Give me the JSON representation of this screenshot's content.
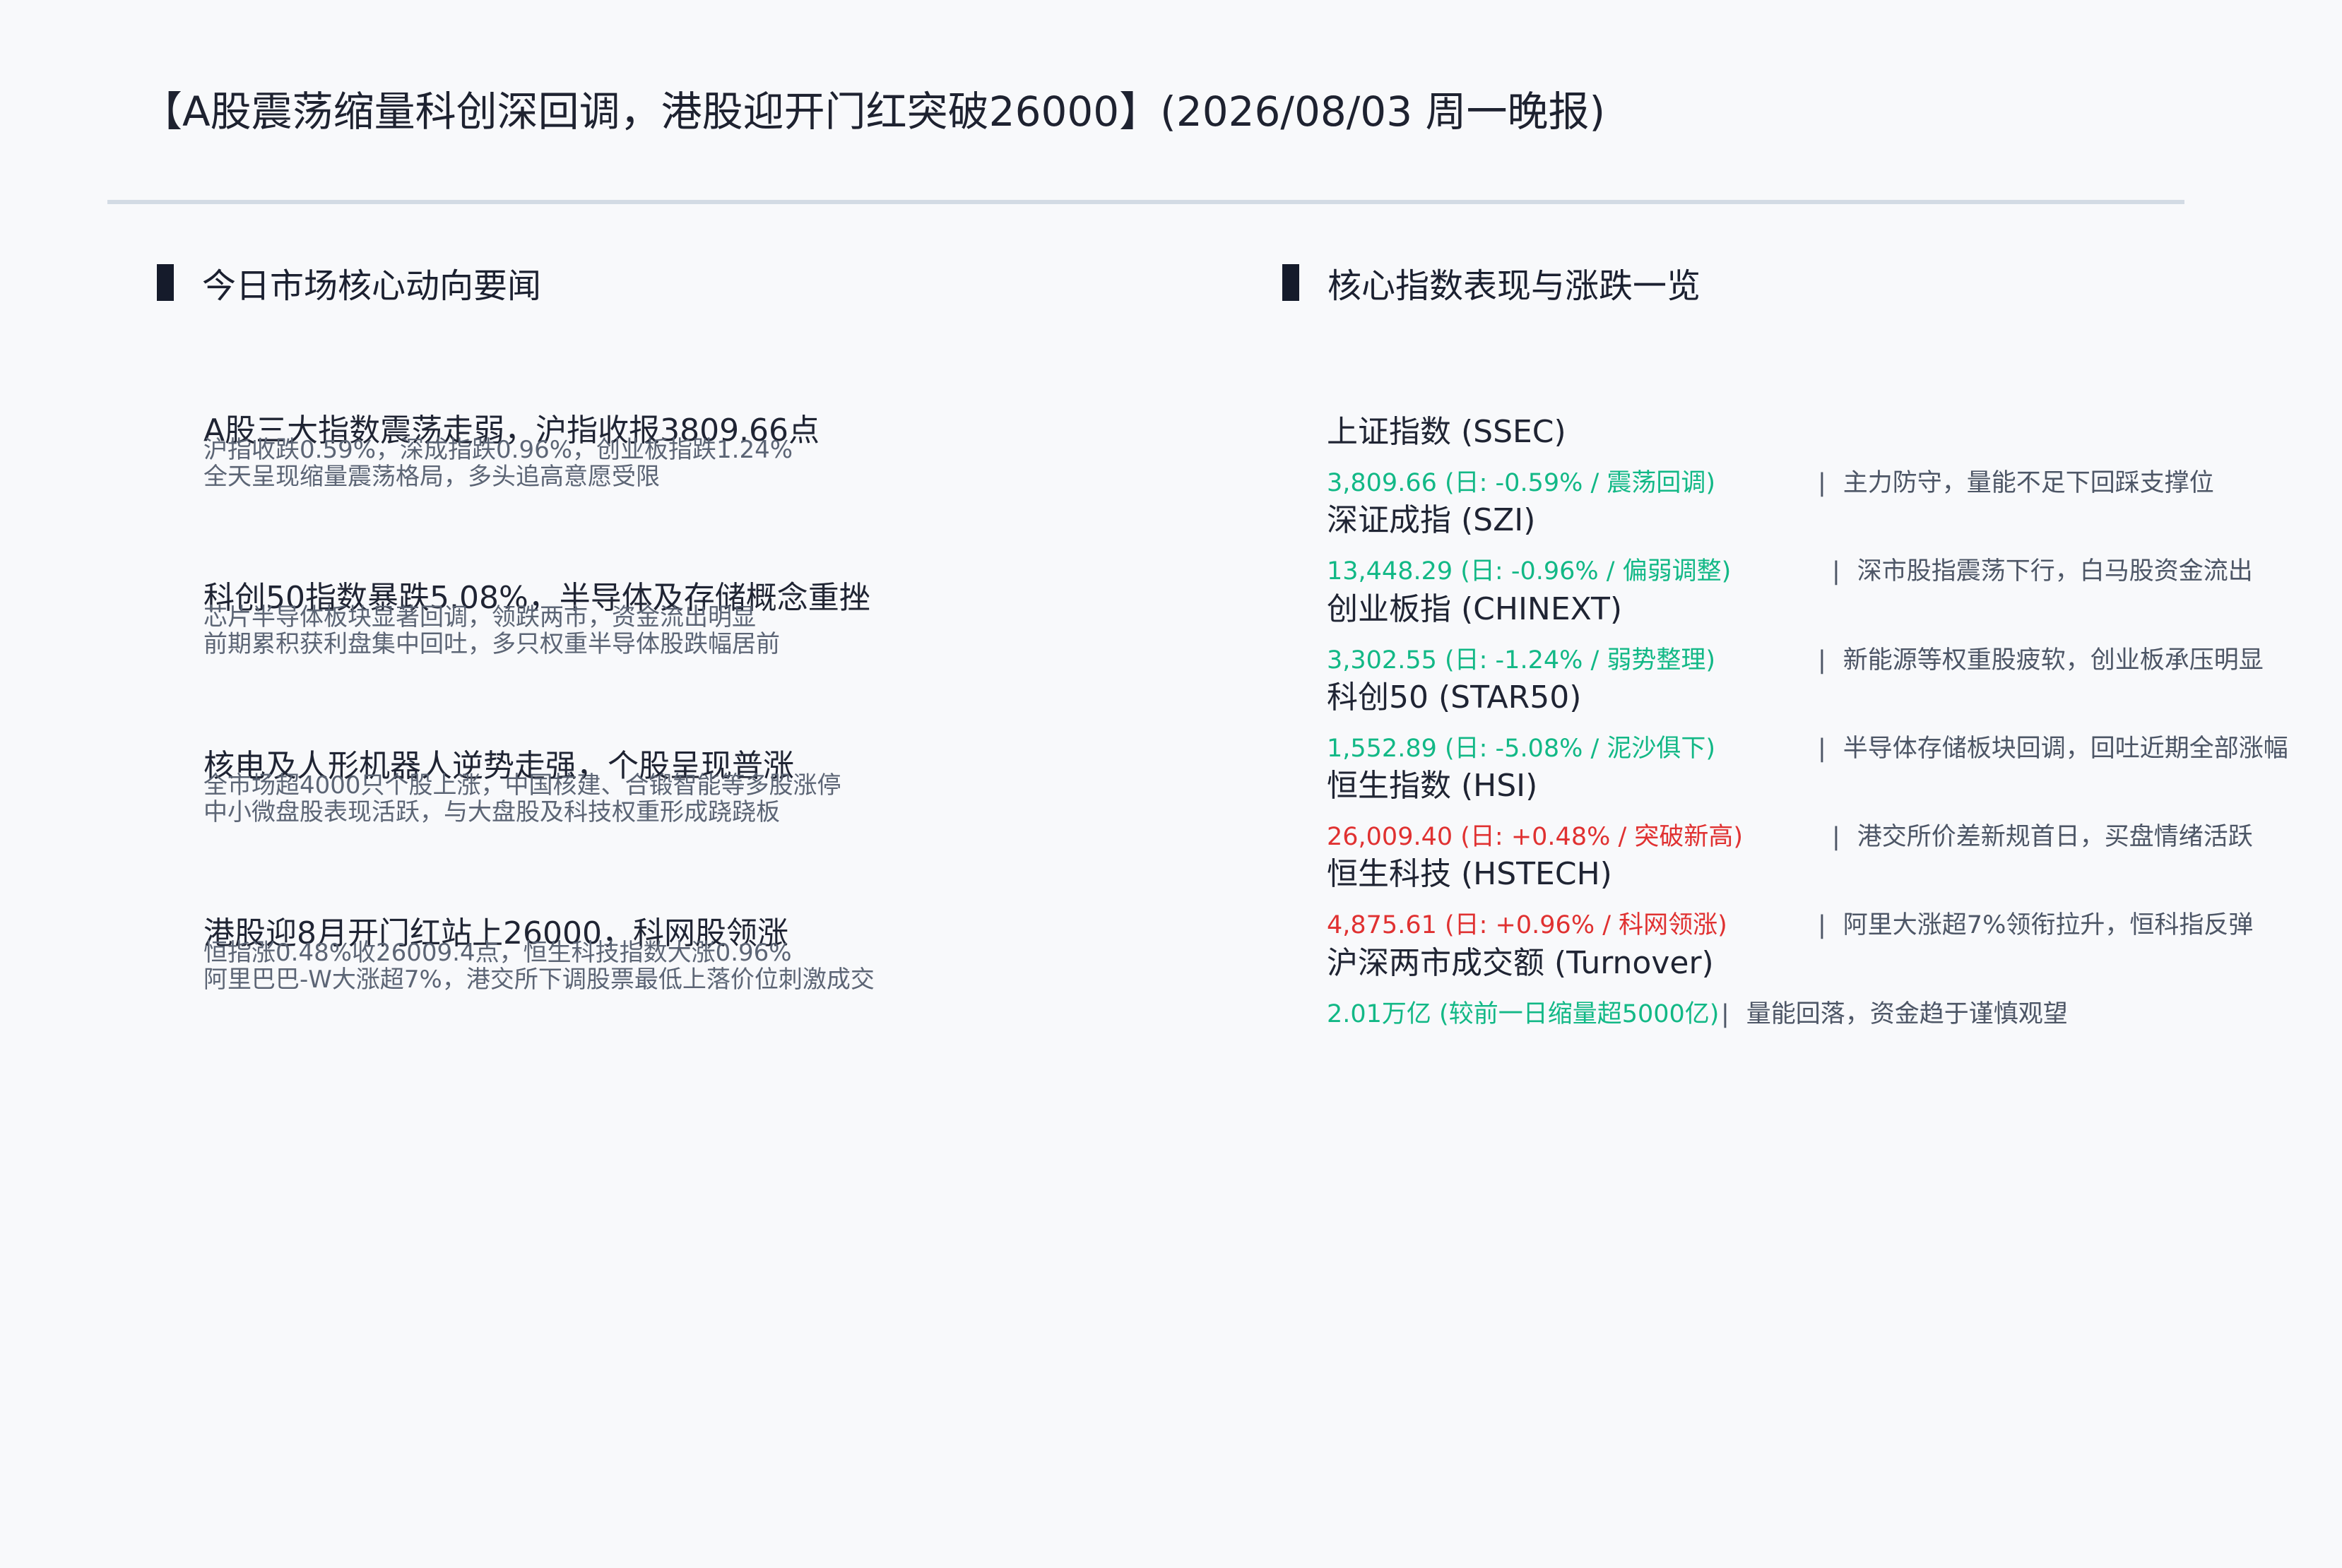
{
  "title": "【A股震荡缩量科创深回调，港股迎开门红突破26000】(2026/08/03 周一晚报)",
  "sections": {
    "left_title": "今日市场核心动向要闻",
    "right_title": "核心指数表现与涨跌一览"
  },
  "news": [
    {
      "headline": "A股三大指数震荡走弱，沪指收报3809.66点",
      "sub1": "沪指收跌0.59%，深成指跌0.96%，创业板指跌1.24%",
      "sub2": "全天呈现缩量震荡格局，多头追高意愿受限"
    },
    {
      "headline": "科创50指数暴跌5.08%，半导体及存储概念重挫",
      "sub1": "芯片半导体板块显著回调，领跌两市，资金流出明显",
      "sub2": "前期累积获利盘集中回吐，多只权重半导体股跌幅居前"
    },
    {
      "headline": "核电及人形机器人逆势走强，个股呈现普涨",
      "sub1": "全市场超4000只个股上涨，中国核建、合锻智能等多股涨停",
      "sub2": "中小微盘股表现活跃，与大盘股及科技权重形成跷跷板"
    },
    {
      "headline": "港股迎8月开门红站上26000，科网股领涨",
      "sub1": "恒指涨0.48%收26009.4点，恒生科技指数大涨0.96%",
      "sub2": "阿里巴巴-W大涨超7%，港交所下调股票最低上落价位刺激成交"
    }
  ],
  "indices": [
    {
      "name": "上证指数 (SSEC)",
      "value": "3,809.66 (日: -0.59% / 震荡回调)",
      "direction": "down",
      "separator": "|",
      "note": "主力防守，量能不足下回踩支撑位"
    },
    {
      "name": "深证成指 (SZI)",
      "value": "13,448.29 (日: -0.96% / 偏弱调整)",
      "direction": "down",
      "separator": "|",
      "note": "深市股指震荡下行，白马股资金流出"
    },
    {
      "name": "创业板指 (CHINEXT)",
      "value": "3,302.55 (日: -1.24% / 弱势整理)",
      "direction": "down",
      "separator": "|",
      "note": "新能源等权重股疲软，创业板承压明显"
    },
    {
      "name": "科创50 (STAR50)",
      "value": "1,552.89 (日: -5.08% / 泥沙俱下)",
      "direction": "down",
      "separator": "|",
      "note": "半导体存储板块回调，回吐近期全部涨幅"
    },
    {
      "name": "恒生指数 (HSI)",
      "value": "26,009.40 (日: +0.48% / 突破新高)",
      "direction": "up",
      "separator": "|",
      "note": "港交所价差新规首日，买盘情绪活跃"
    },
    {
      "name": "恒生科技 (HSTECH)",
      "value": "4,875.61 (日: +0.96% / 科网领涨)",
      "direction": "up",
      "separator": "|",
      "note": "阿里大涨超7%领衔拉升，恒科指反弹"
    },
    {
      "name": "沪深两市成交额 (Turnover)",
      "value": "2.01万亿 (较前一日缩量超5000亿)",
      "direction": "down",
      "separator": "|",
      "note": "量能回落，资金趋于谨慎观望"
    }
  ],
  "colors": {
    "down": "#12b886",
    "up": "#e03131",
    "rule": "#d3dbe4",
    "bar": "#151b2b"
  }
}
